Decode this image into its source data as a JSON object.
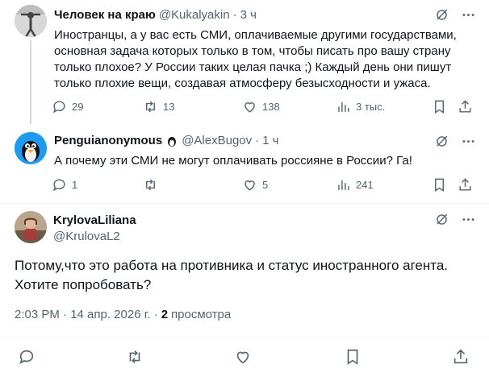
{
  "tweets": [
    {
      "name": "Человек на краю",
      "handle": "@Kukalyakin",
      "dot": "·",
      "time": "3 ч",
      "text": "Иностранцы, а у вас есть СМИ, оплачиваемые другими государствами, основная задача которых только в том, чтобы писать про вашу страну только плохое? У России таких целая пачка ;) Каждый день они пишут только плохие вещи, создавая атмосферу безысходности и ужаса.",
      "replies": "29",
      "retweets": "13",
      "likes": "138",
      "views": "3 тыс."
    },
    {
      "name": "Penguianonymous",
      "handle": "@AlexBugov",
      "dot": "·",
      "time": "1 ч",
      "text": "А почему эти СМИ не могут оплачивать россияне в России? Га!",
      "replies": "1",
      "retweets": "",
      "likes": "5",
      "views": "241"
    }
  ],
  "main_tweet": {
    "name": "KrylovaLiliana",
    "handle": "@KrulovaL2",
    "text": "Потому,что это работа на противника и статус иностранного агента. Хотите попробовать?",
    "timestamp": "2:03 PM · 14 апр. 2026 г. ·",
    "views_count": "2",
    "views_label": "просмотра"
  },
  "icons": {
    "reply": "reply-icon",
    "retweet": "retweet-icon",
    "like": "heart-icon",
    "views": "views-icon",
    "bookmark": "bookmark-icon",
    "share": "share-icon",
    "grok": "grok-icon",
    "more": "more-icon"
  }
}
